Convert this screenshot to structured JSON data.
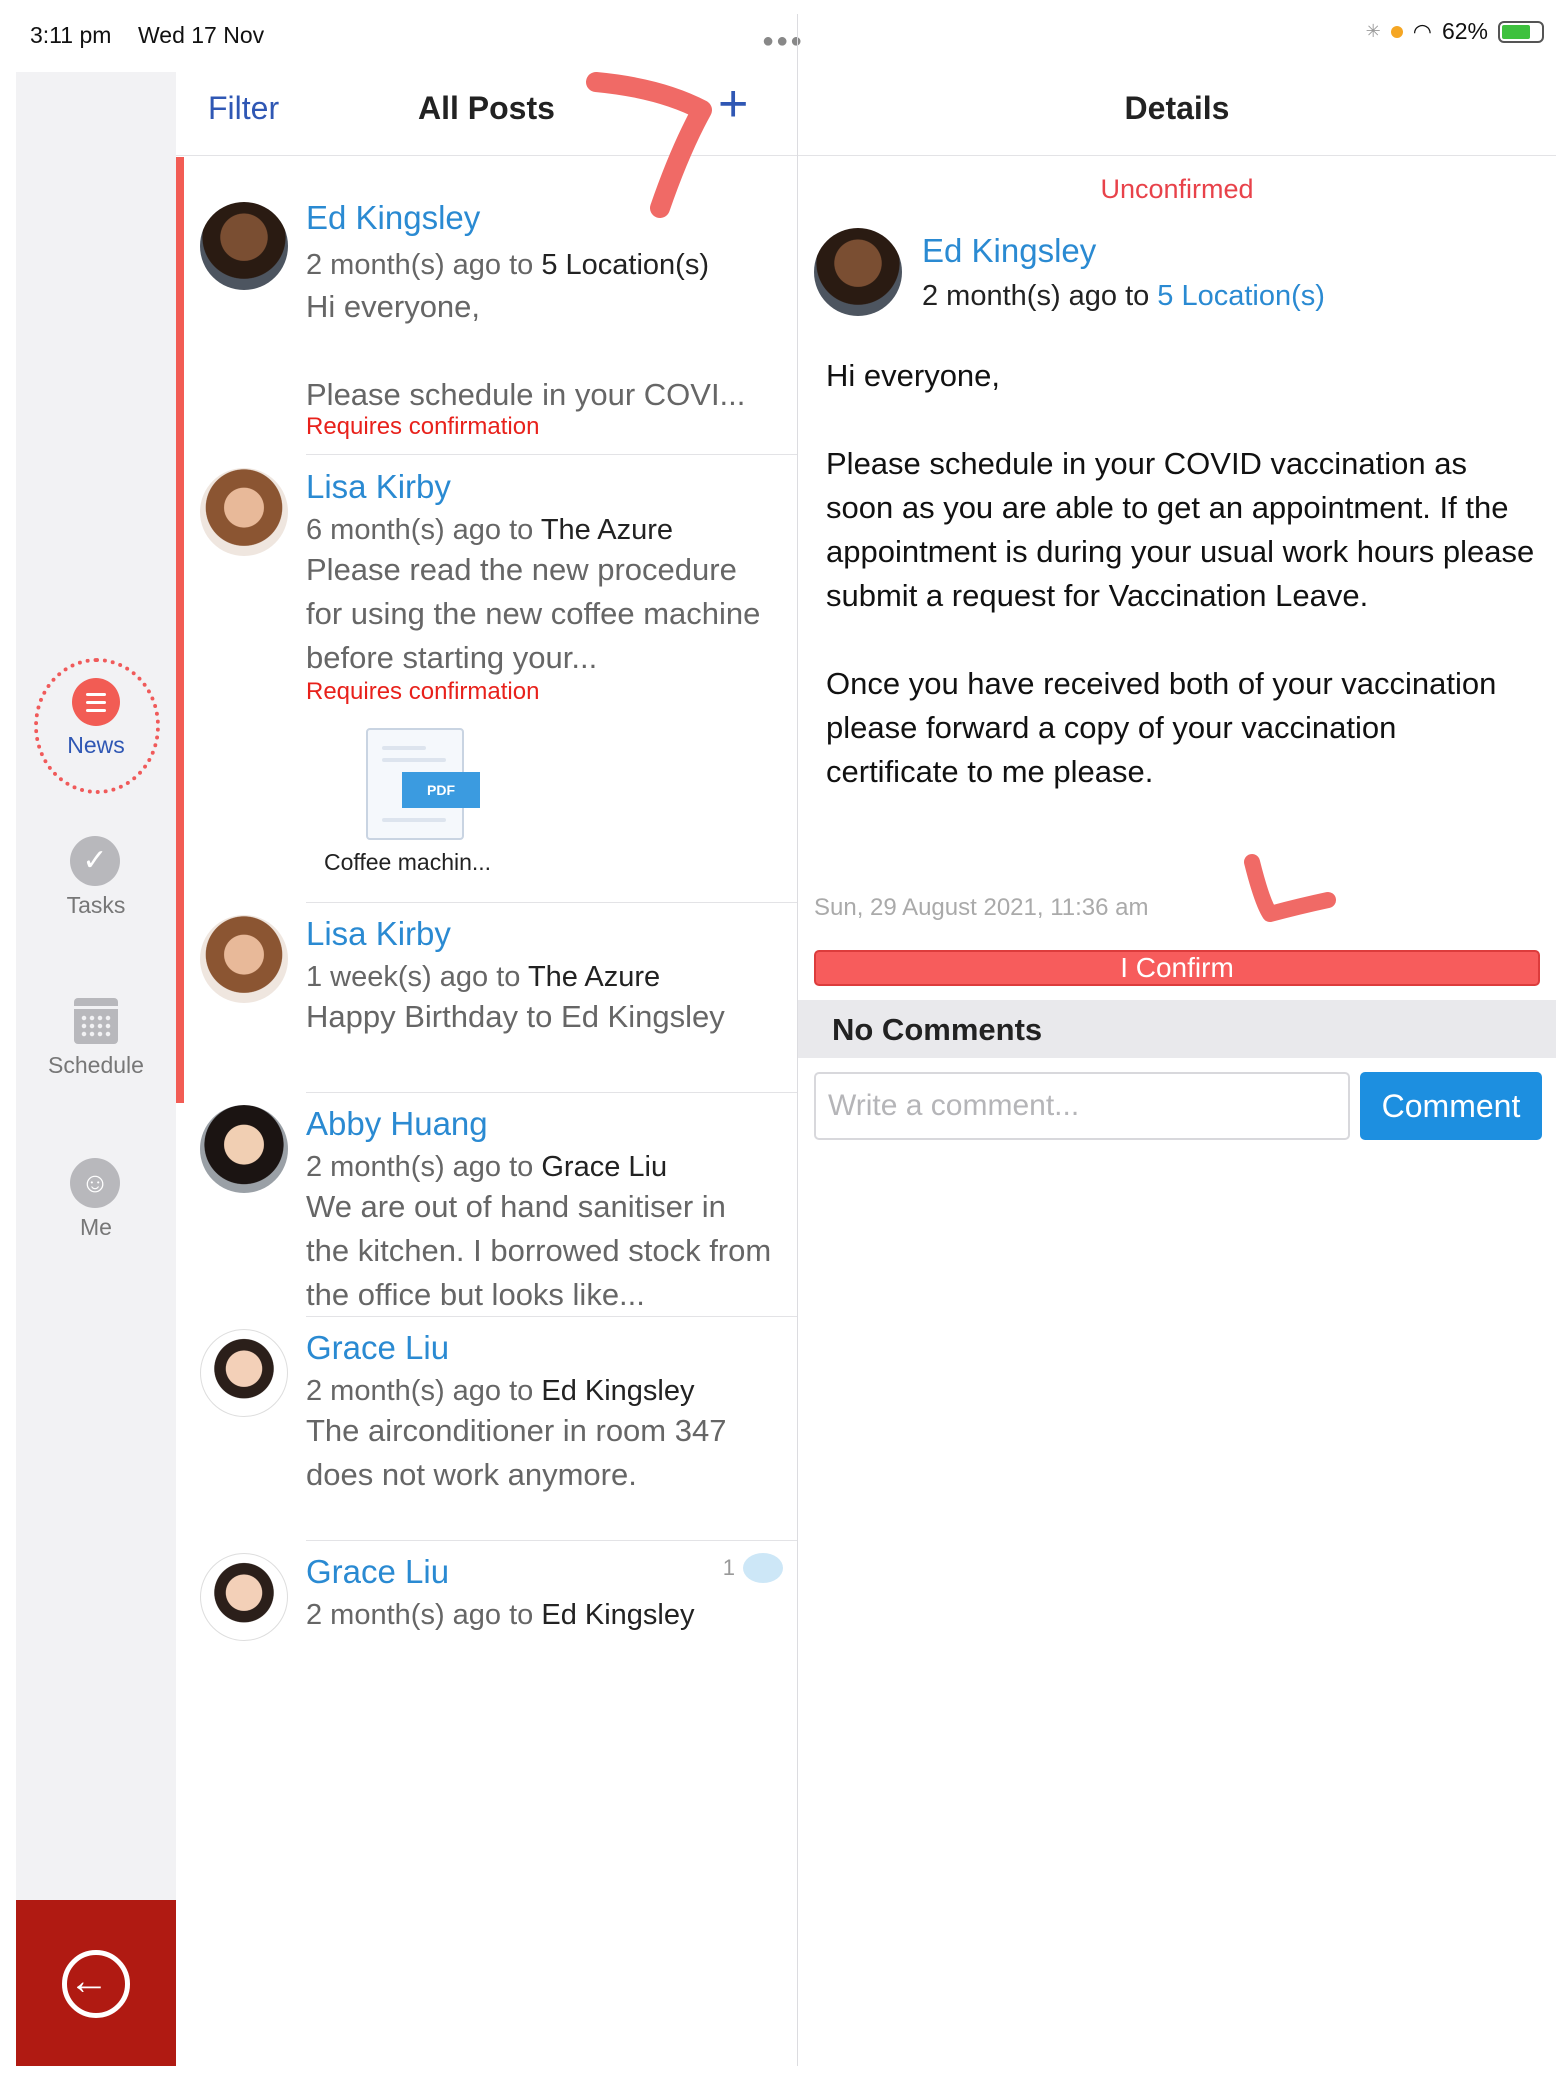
{
  "status_bar": {
    "time": "3:11 pm",
    "date": "Wed 17 Nov",
    "battery": "62%"
  },
  "nav": {
    "news": "News",
    "tasks": "Tasks",
    "schedule": "Schedule",
    "me": "Me"
  },
  "posts_header": {
    "filter": "Filter",
    "title": "All Posts",
    "add": "+"
  },
  "posts": [
    {
      "author": "Ed Kingsley",
      "meta_prefix": "2 month(s) ago to",
      "target": "5 Location(s)",
      "body": "Hi everyone,\n\nPlease schedule in your COVI...",
      "requirement": "Requires confirmation"
    },
    {
      "author": "Lisa Kirby",
      "meta_prefix": "6 month(s) ago to",
      "target": "The Azure",
      "body": "Please read the new procedure for using the new coffee machine before starting your...",
      "requirement": "Requires confirmation",
      "attachment": {
        "type": "PDF",
        "name": "Coffee machin..."
      }
    },
    {
      "author": "Lisa Kirby",
      "meta_prefix": "1 week(s) ago to",
      "target": "The Azure",
      "body": "Happy Birthday to Ed Kingsley"
    },
    {
      "author": "Abby Huang",
      "meta_prefix": "2 month(s) ago to",
      "target": "Grace Liu",
      "body": "We are out of hand sanitiser in the kitchen. I borrowed stock from the office but looks like..."
    },
    {
      "author": "Grace Liu",
      "meta_prefix": "2 month(s) ago to",
      "target": "Ed Kingsley",
      "body": "The airconditioner in room 347 does not work anymore."
    },
    {
      "author": "Grace Liu",
      "meta_prefix": "2 month(s) ago to",
      "target": "Ed Kingsley",
      "comment_count": "1"
    }
  ],
  "details": {
    "title": "Details",
    "status": "Unconfirmed",
    "author": "Ed Kingsley",
    "meta_prefix": "2 month(s) ago to",
    "target": "5 Location(s)",
    "body": "Hi everyone,\n\nPlease schedule in your COVID vaccination as soon as you are able to get an appointment. If the appointment is during your usual work hours please submit a request for Vaccination Leave.\n\nOnce you have received both of your vaccination please forward a copy of your vaccination certificate to me please.",
    "date": "Sun, 29 August 2021, 11:36 am",
    "confirm_label": "I Confirm",
    "comments_heading": "No Comments",
    "comment_placeholder": "Write a comment...",
    "comment_button": "Comment"
  },
  "colors": {
    "accent_blue": "#2a8ad2",
    "alert_red": "#f25c54",
    "logout_red": "#b01a12"
  }
}
